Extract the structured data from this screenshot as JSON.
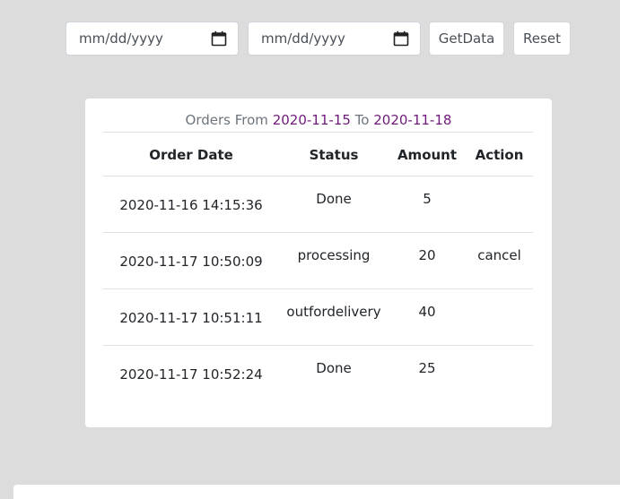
{
  "filters": {
    "from_placeholder": "mm/dd/yyyy",
    "to_placeholder": "mm/dd/yyyy",
    "calendar_icon": "calendar-icon",
    "getdata_label": "GetData",
    "reset_label": "Reset"
  },
  "orders": {
    "caption_prefix": "Orders From",
    "from_date": "2020-11-15",
    "caption_mid": "To",
    "to_date": "2020-11-18",
    "columns": [
      "Order Date",
      "Status",
      "Amount",
      "Action"
    ],
    "rows": [
      {
        "date": "2020-11-16 14:15:36",
        "status": "Done",
        "amount": "5",
        "action": ""
      },
      {
        "date": "2020-11-17 10:50:09",
        "status": "processing",
        "amount": "20",
        "action": "cancel"
      },
      {
        "date": "2020-11-17 10:51:11",
        "status": "outfordelivery",
        "amount": "40",
        "action": ""
      },
      {
        "date": "2020-11-17 10:52:24",
        "status": "Done",
        "amount": "25",
        "action": ""
      }
    ]
  },
  "colors": {
    "background": "#dcdcdc",
    "date_accent": "#6f1a7a"
  }
}
